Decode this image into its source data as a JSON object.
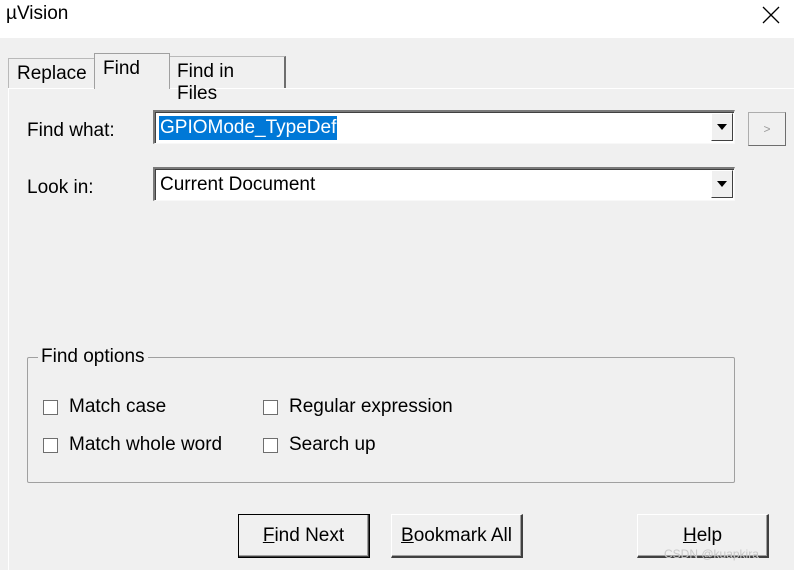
{
  "window": {
    "title": "µVision"
  },
  "tabs": [
    {
      "label": "Replace"
    },
    {
      "label": "Find",
      "active": true
    },
    {
      "label": "Find in Files"
    }
  ],
  "find_what": {
    "label": "Find what:",
    "value": "GPIOMode_TypeDef"
  },
  "look_in": {
    "label": "Look in:",
    "value": "Current Document"
  },
  "side_button": {
    "label": ">"
  },
  "find_options": {
    "legend": "Find options",
    "match_case": {
      "label": "Match case",
      "checked": false
    },
    "match_whole_word": {
      "label": "Match whole word",
      "checked": false
    },
    "regular_expression": {
      "label": "Regular expression",
      "checked": false
    },
    "search_up": {
      "label": "Search up",
      "checked": false
    }
  },
  "buttons": {
    "find_next": {
      "mnemonic": "F",
      "rest": "ind Next"
    },
    "bookmark_all": {
      "mnemonic": "B",
      "rest": "ookmark All"
    },
    "help": {
      "mnemonic": "H",
      "rest": "elp"
    }
  },
  "watermark": "CSDN @kuapkira",
  "colors": {
    "selection": "#0078d7",
    "background": "#f0f0f0"
  }
}
